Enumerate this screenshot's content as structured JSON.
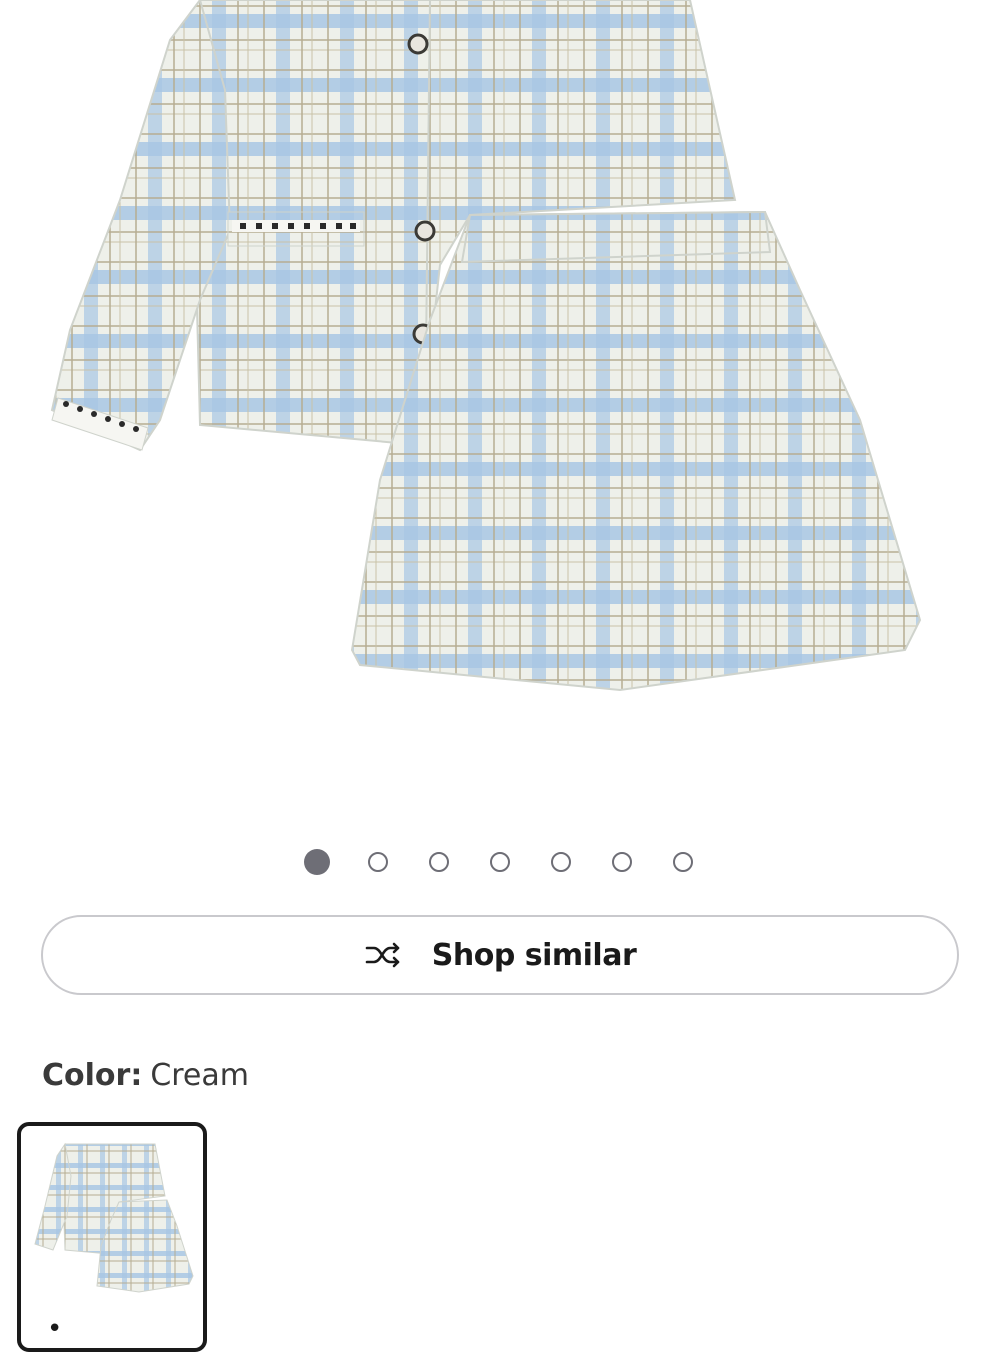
{
  "product_image": {
    "alt": "Blue and cream tweed plaid jacket and skirt set"
  },
  "carousel": {
    "total": 7,
    "active_index": 0
  },
  "shop_similar": {
    "label": "Shop similar",
    "icon": "shuffle-icon"
  },
  "color": {
    "label": "Color:",
    "value": "Cream",
    "swatches": [
      {
        "name": "Cream",
        "selected": true
      }
    ]
  },
  "colors": {
    "fabric_base": "#eef0ea",
    "fabric_blue": "#a9c7e4",
    "fabric_thread": "#b6ad92",
    "outline": "#cfd3cc",
    "dot_color": "#6e6e76"
  }
}
